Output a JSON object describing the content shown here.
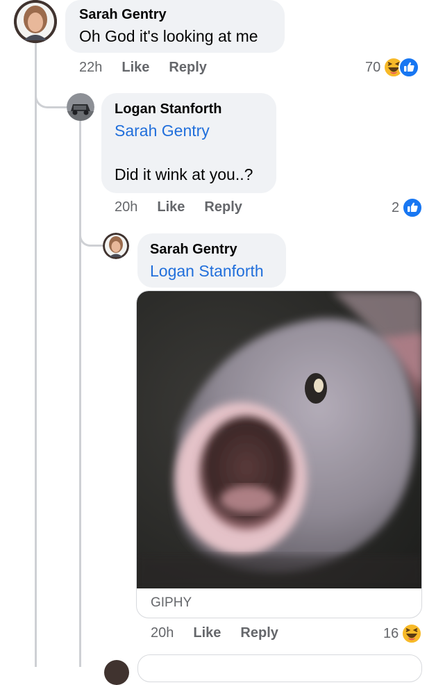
{
  "comments": [
    {
      "author": "Sarah Gentry",
      "text": "Oh God it's looking at me",
      "time": "22h",
      "like_label": "Like",
      "reply_label": "Reply",
      "reaction_count": "70",
      "reactions": [
        "haha-icon",
        "like-icon"
      ]
    },
    {
      "author": "Logan Stanforth",
      "mention": "Sarah Gentry",
      "text": "Did it wink at you..?",
      "time": "20h",
      "like_label": "Like",
      "reply_label": "Reply",
      "reaction_count": "2",
      "reactions": [
        "like-icon"
      ]
    },
    {
      "author": "Sarah Gentry",
      "mention": "Logan Stanforth",
      "gif_caption": "GIPHY",
      "time": "20h",
      "like_label": "Like",
      "reply_label": "Reply",
      "reaction_count": "16",
      "reactions": [
        "haha-icon"
      ]
    }
  ],
  "colors": {
    "bubble": "#f0f2f5",
    "mention": "#216fdb",
    "meta": "#65676b",
    "like_blue": "#1877f2",
    "haha_yellow": "#f7b928"
  }
}
